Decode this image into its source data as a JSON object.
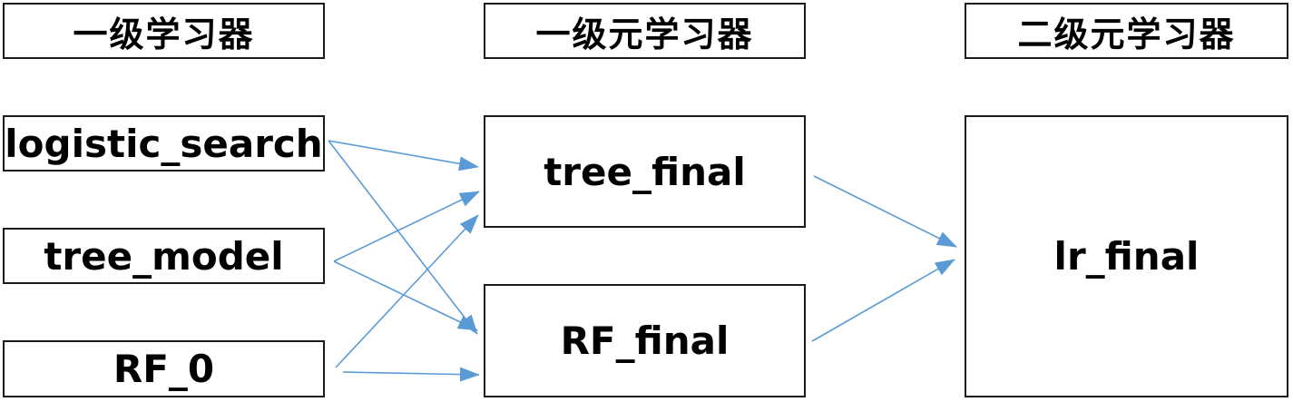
{
  "headers": {
    "level1_learners": "一级学习器",
    "level1_meta_learners": "一级元学习器",
    "level2_meta_learners": "二级元学习器"
  },
  "base_learners": [
    "logistic_search",
    "tree_model",
    "RF_0"
  ],
  "meta_learners": [
    "tree_final",
    "RF_final"
  ],
  "final_learner": "lr_final",
  "colors": {
    "arrow": "#5b9bd5",
    "border": "#1a1a1a",
    "text": "#000000"
  }
}
